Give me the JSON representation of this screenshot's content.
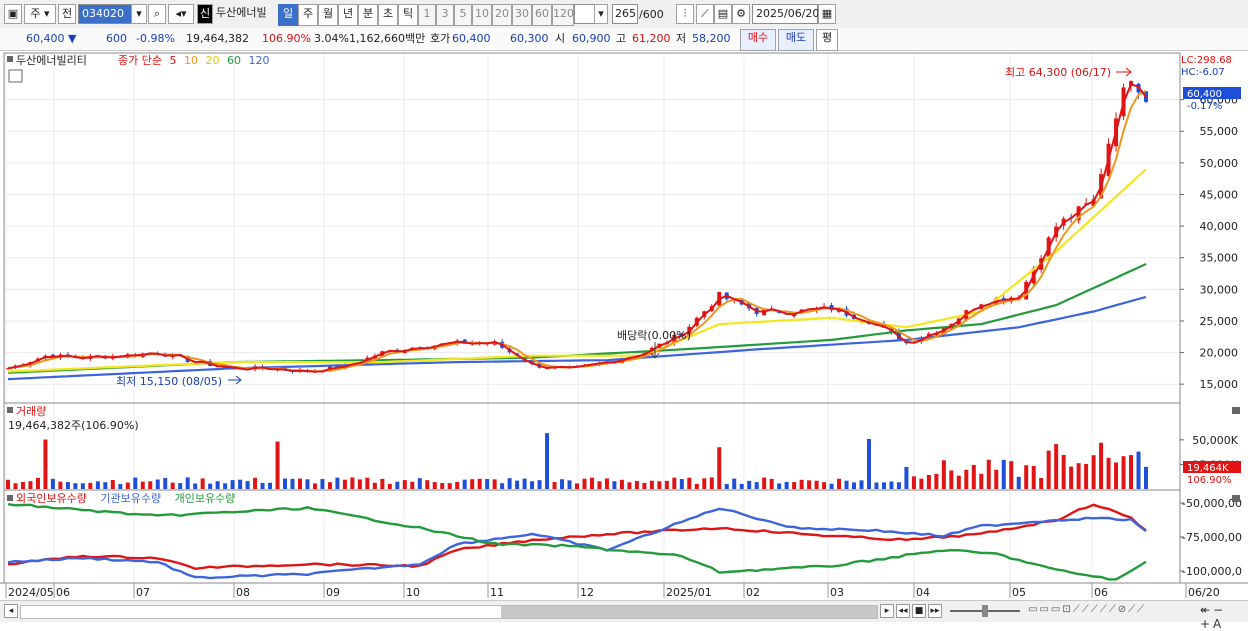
{
  "toolbar": {
    "market": "주",
    "prev": "전",
    "code": "034020",
    "new_badge": "신",
    "name": "두산에너빌",
    "periods": [
      "일",
      "주",
      "월",
      "년",
      "분",
      "초",
      "틱"
    ],
    "active_period": "일",
    "minute_options": [
      "1",
      "3",
      "5",
      "10",
      "20",
      "30",
      "60",
      "120"
    ],
    "count": "265",
    "count_total": "/600",
    "date": "2025/06/20"
  },
  "quote": {
    "price": "60,400",
    "change": "600",
    "change_pct": "-0.98%",
    "volume": "19,464,382",
    "volume_ratio": "106.90%",
    "turnover": "3.04%",
    "amount": "1,162,660백만",
    "bid_label": "호가",
    "ask": "60,400",
    "bid": "60,300",
    "open_label": "시",
    "open": "60,900",
    "high_label": "고",
    "high": "61,200",
    "low_label": "저",
    "low": "58,200",
    "buy_btn": "매수",
    "sell_btn": "매도",
    "eval_btn": "평"
  },
  "colors": {
    "up": "#e01414",
    "down": "#1f4fd8",
    "ma5": "#e01414",
    "ma10": "#f0961e",
    "ma20": "#f2e61e",
    "ma60": "#239b3c",
    "ma120": "#3c64dc"
  },
  "price_panel": {
    "title": "두산에너빌리티",
    "legend": [
      {
        "label": "종가 단순",
        "color": "#e01414"
      },
      {
        "label": "5",
        "color": "#e01414"
      },
      {
        "label": "10",
        "color": "#f0961e"
      },
      {
        "label": "20",
        "color": "#e6c800"
      },
      {
        "label": "60",
        "color": "#239b3c"
      },
      {
        "label": "120",
        "color": "#3c64dc"
      }
    ],
    "lc": "LC:298.68",
    "hc": "HC:-6.07",
    "current_label": "60,400",
    "current_pct": "-0.17%",
    "high_annot": "최고 64,300 (06/17)",
    "low_annot": "최저 15,150 (08/05)",
    "div_annot": "배당락(0.00%)"
  },
  "volume_panel": {
    "title": "거래량",
    "info": "19,464,382주(106.90%)",
    "current_label": "19,464K",
    "current_pct": "106.90%"
  },
  "holdings_panel": {
    "foreign": "외국인보유수량",
    "institution": "기관보유수량",
    "individual": "개인보유수량"
  },
  "chart_data": [
    {
      "type": "candlestick",
      "price_axis_ticks": [
        "60,000",
        "55,000",
        "50,000",
        "45,000",
        "40,000",
        "35,000",
        "30,000",
        "25,000",
        "20,000",
        "15,000"
      ],
      "ylim": [
        12500,
        65000
      ],
      "x_labels": [
        "2024/05",
        "06",
        "07",
        "08",
        "09",
        "10",
        "11",
        "12",
        "2025/01",
        "02",
        "03",
        "04",
        "05",
        "06",
        "06/20"
      ],
      "close_path": [
        [
          0,
          17500
        ],
        [
          5,
          19500
        ],
        [
          10,
          19200
        ],
        [
          15,
          19500
        ],
        [
          20,
          20000
        ],
        [
          25,
          18500
        ],
        [
          30,
          17500
        ],
        [
          35,
          17500
        ],
        [
          40,
          17000
        ],
        [
          45,
          17800
        ],
        [
          50,
          20000
        ],
        [
          55,
          21000
        ],
        [
          60,
          21500
        ],
        [
          65,
          21500
        ],
        [
          70,
          18000
        ],
        [
          75,
          17300
        ],
        [
          80,
          18500
        ],
        [
          85,
          20000
        ],
        [
          90,
          23000
        ],
        [
          95,
          29000
        ],
        [
          100,
          26500
        ],
        [
          105,
          26500
        ],
        [
          110,
          27000
        ],
        [
          115,
          25000
        ],
        [
          120,
          21500
        ],
        [
          125,
          24000
        ],
        [
          130,
          28000
        ],
        [
          135,
          29000
        ],
        [
          140,
          40000
        ],
        [
          145,
          44000
        ],
        [
          148,
          58000
        ],
        [
          150,
          64000
        ],
        [
          152,
          60400
        ]
      ],
      "ma20_path": [
        [
          0,
          17000
        ],
        [
          30,
          18500
        ],
        [
          50,
          18500
        ],
        [
          70,
          19500
        ],
        [
          85,
          19500
        ],
        [
          95,
          24500
        ],
        [
          110,
          25500
        ],
        [
          120,
          24000
        ],
        [
          130,
          26500
        ],
        [
          140,
          36000
        ],
        [
          152,
          49000
        ]
      ],
      "ma60_path": [
        [
          0,
          16800
        ],
        [
          30,
          18500
        ],
        [
          50,
          18800
        ],
        [
          70,
          19200
        ],
        [
          90,
          20500
        ],
        [
          110,
          22000
        ],
        [
          120,
          23500
        ],
        [
          130,
          24500
        ],
        [
          140,
          27500
        ],
        [
          152,
          34000
        ]
      ],
      "ma120_path": [
        [
          0,
          15800
        ],
        [
          30,
          17500
        ],
        [
          60,
          18500
        ],
        [
          80,
          18800
        ],
        [
          100,
          20500
        ],
        [
          120,
          22000
        ],
        [
          135,
          24000
        ],
        [
          145,
          26500
        ],
        [
          152,
          28800
        ]
      ]
    },
    {
      "type": "bar",
      "name": "거래량",
      "axis_ticks": [
        "50,000K",
        "25,000K"
      ],
      "ylim": [
        0,
        60000
      ]
    },
    {
      "type": "line",
      "axis_ticks": [
        "-50,000,00",
        "-75,000,00",
        "-100,000,0"
      ],
      "series": [
        {
          "name": "외국인보유수량",
          "color": "#e01414"
        },
        {
          "name": "기관보유수량",
          "color": "#3c64dc"
        },
        {
          "name": "개인보유수량",
          "color": "#239b3c"
        }
      ]
    }
  ]
}
